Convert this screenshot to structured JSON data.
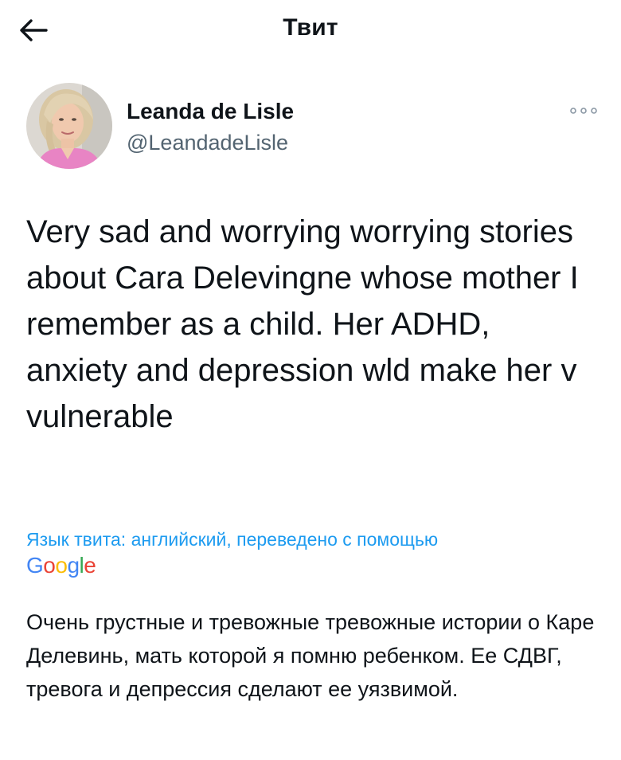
{
  "header": {
    "title": "Твит",
    "back_icon": "arrow-left-icon"
  },
  "author": {
    "name": "Leanda de Lisle",
    "handle": "@LeandadeLisle",
    "more_icon": "more-horizontal-icon"
  },
  "tweet": {
    "text": "Very sad and worrying worrying stories about Cara Delevingne whose mother I remember as a child. Her ADHD, anxiety and depression wld make her v vulnerable"
  },
  "translation": {
    "note": "Язык твита: английский, переведено с помощью",
    "provider": "Google",
    "text": "Очень грустные и тревожные тревожные истории о Каре Делевинь, мать которой я помню ребенком. Ее СДВГ, тревога и депрессия сделают ее уязвимой."
  },
  "colors": {
    "link": "#1d9bf0",
    "secondary": "#536471",
    "text": "#0f1419"
  }
}
